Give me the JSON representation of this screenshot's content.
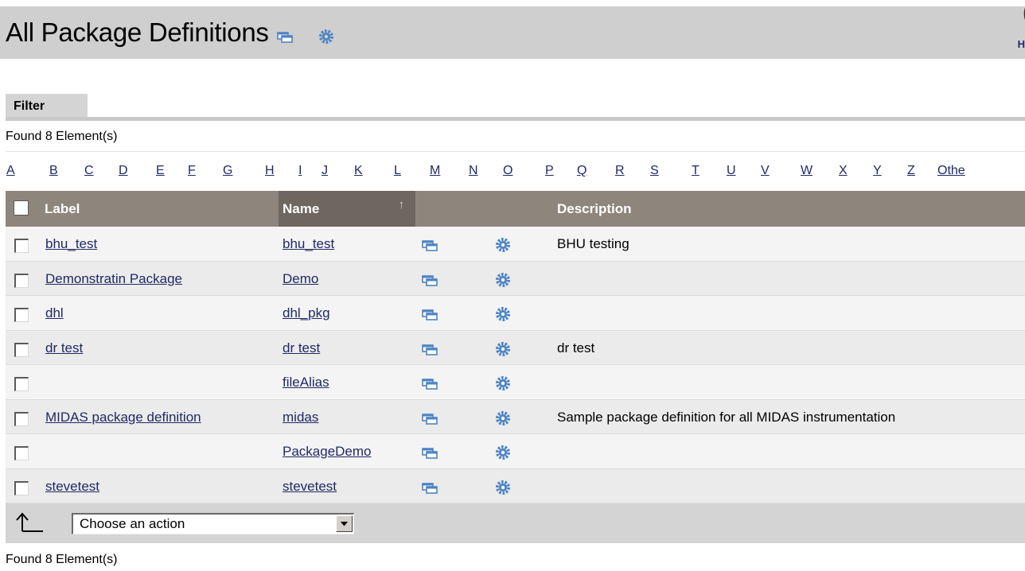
{
  "header": {
    "title": "All Package Definitions",
    "new_window_icon": "new-window-icon",
    "settings_icon": "gear-icon",
    "help_glyph": "(",
    "help_label": "H"
  },
  "filter": {
    "tab_label": "Filter"
  },
  "results": {
    "found_text_top": "Found 8 Element(s)",
    "found_text_bottom": "Found 8 Element(s)"
  },
  "alphabet": [
    "A",
    "B",
    "C",
    "D",
    "E",
    "F",
    "G",
    "H",
    "I",
    "J",
    "K",
    "L",
    "M",
    "N",
    "O",
    "P",
    "Q",
    "R",
    "S",
    "T",
    "U",
    "V",
    "W",
    "X",
    "Y",
    "Z",
    "Othe"
  ],
  "table": {
    "columns": {
      "label": "Label",
      "name": "Name",
      "description": "Description"
    },
    "sort_column": "Name",
    "sort_direction": "ascending",
    "rows": [
      {
        "label": "bhu_test",
        "name": "bhu_test",
        "description": "BHU testing"
      },
      {
        "label": "Demonstratin Package",
        "name": "Demo",
        "description": ""
      },
      {
        "label": "dhl",
        "name": "dhl_pkg",
        "description": ""
      },
      {
        "label": "dr test",
        "name": "dr test",
        "description": "dr test"
      },
      {
        "label": "",
        "name": "fileAlias",
        "description": ""
      },
      {
        "label": "MIDAS package definition",
        "name": "midas",
        "description": "Sample package definition for all MIDAS instrumentation"
      },
      {
        "label": "",
        "name": "PackageDemo",
        "description": ""
      },
      {
        "label": "stevetest",
        "name": "stevetest",
        "description": ""
      }
    ]
  },
  "actions": {
    "select_value": "Choose an action"
  },
  "colors": {
    "header_bg": "#cfcfcf",
    "table_header_bg": "#8e857d",
    "sorted_header_bg": "#6e665f",
    "link": "#1f2a66",
    "gear_blue": "#4d84c4"
  }
}
